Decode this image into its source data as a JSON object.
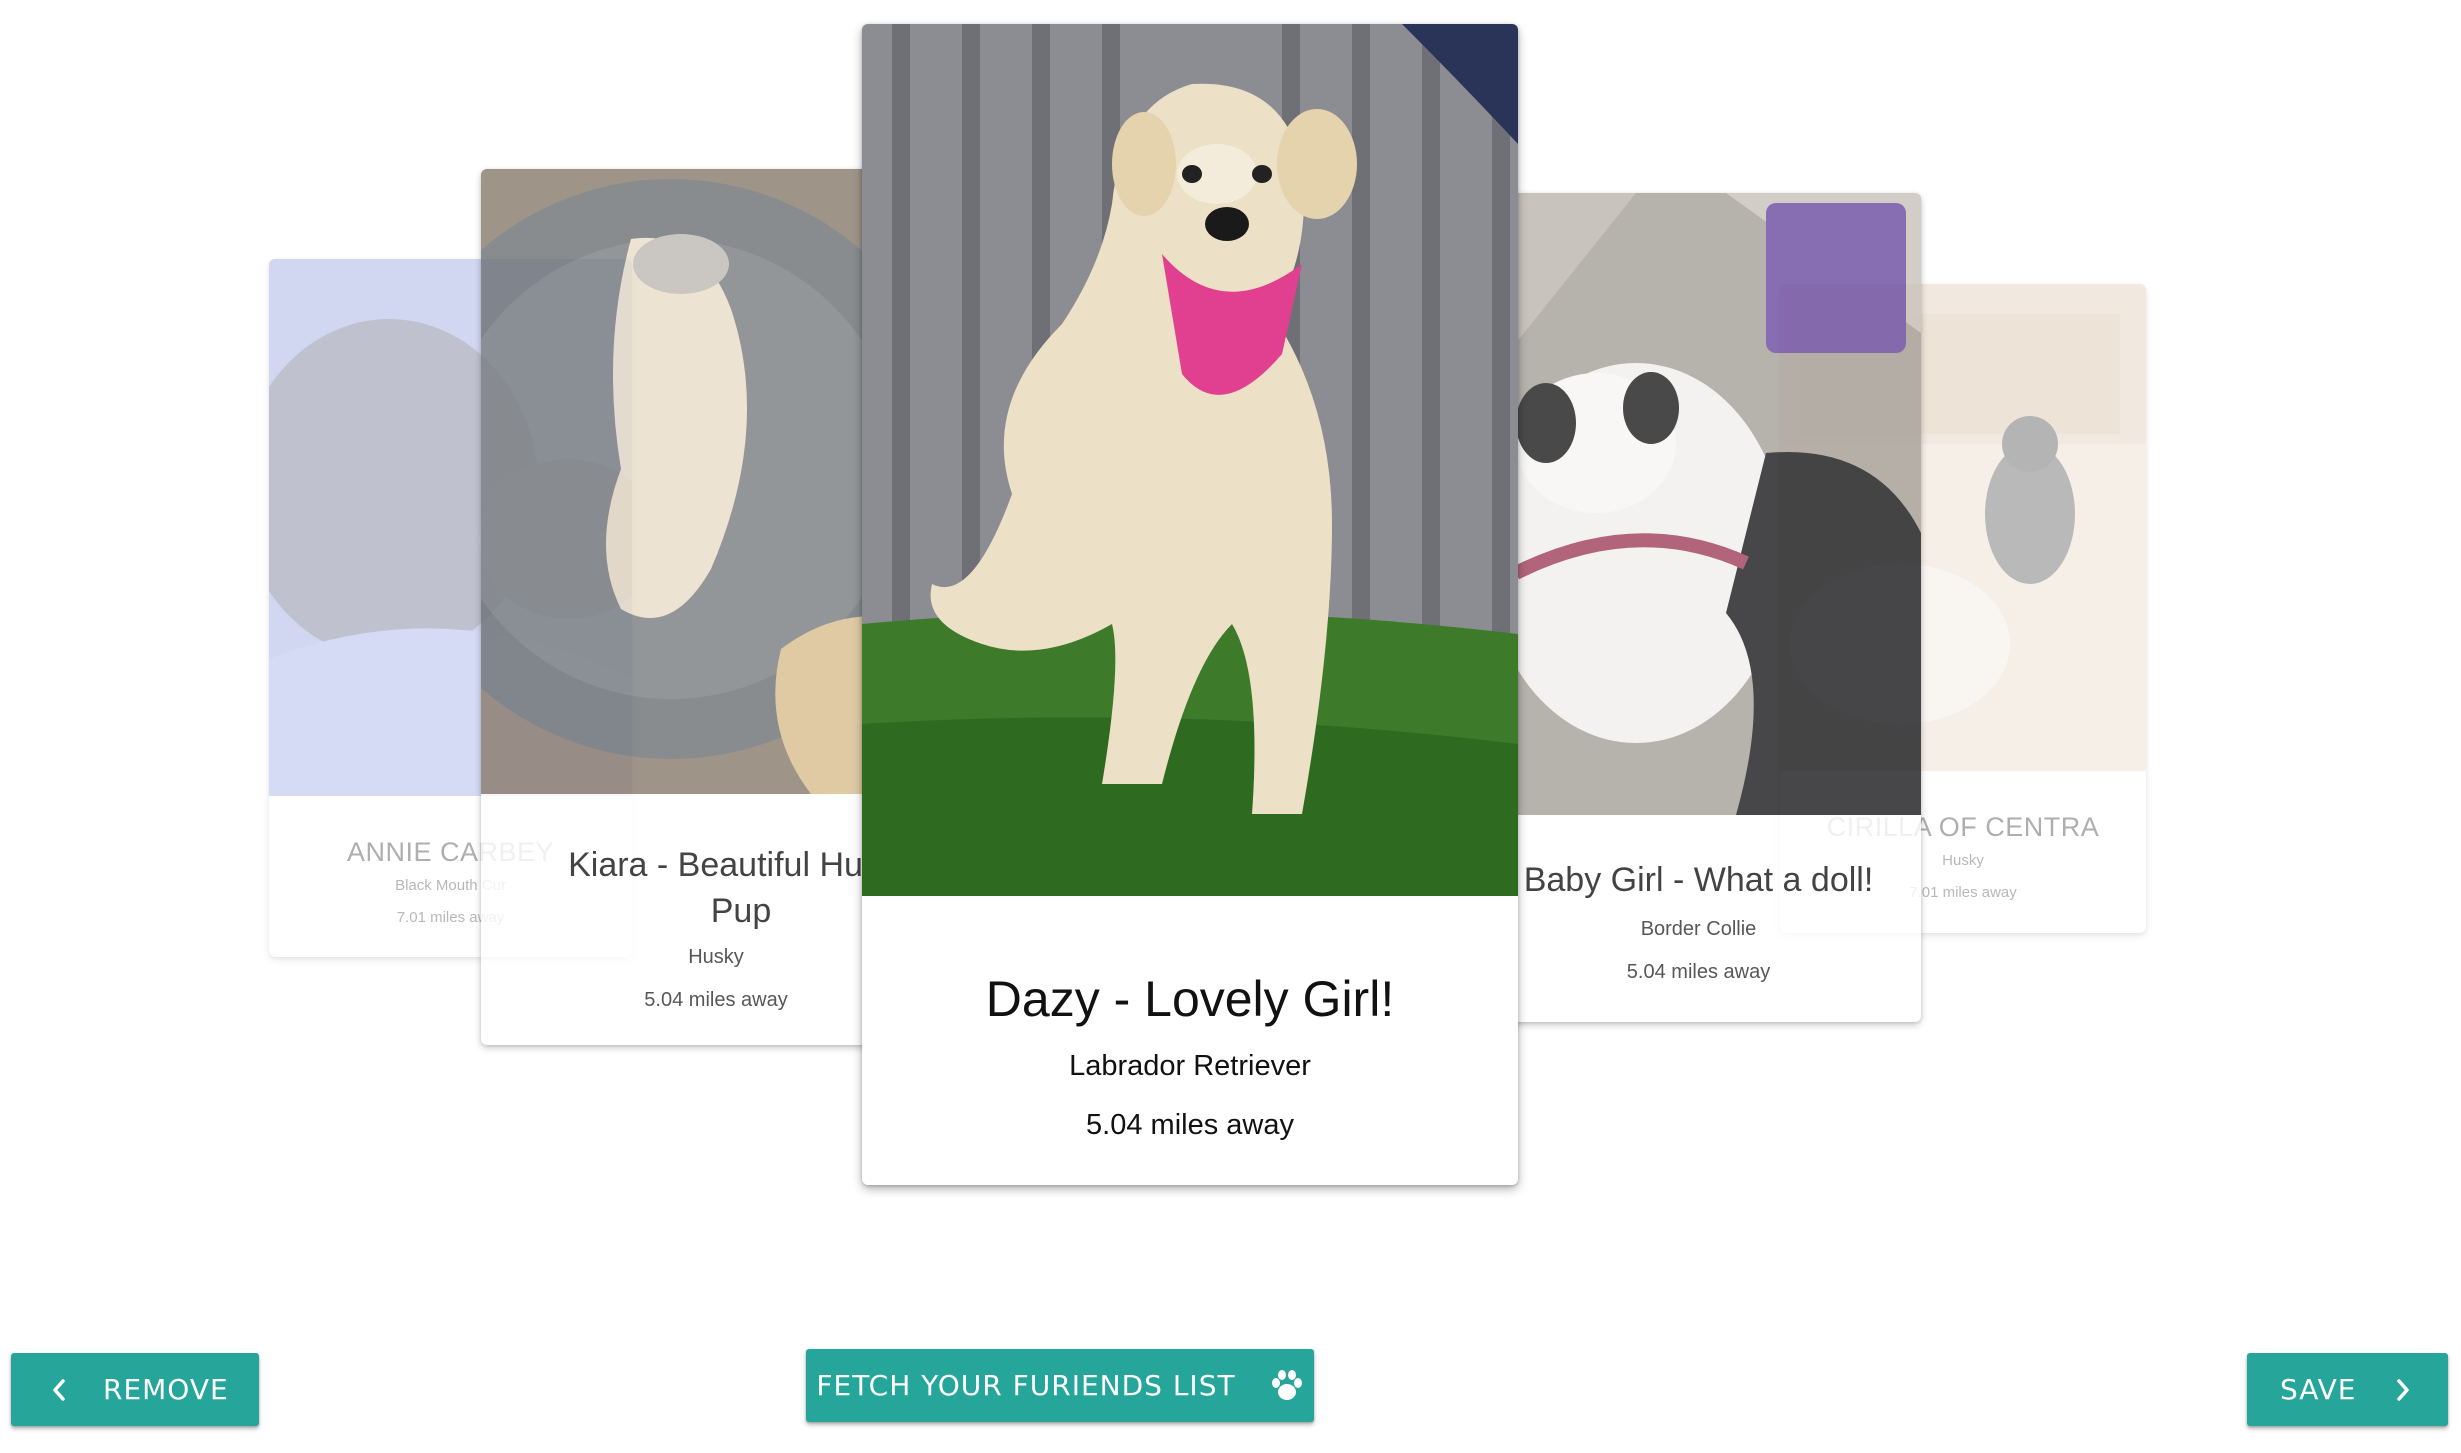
{
  "cards": {
    "annie": {
      "name": "ANNIE CARBEY",
      "breed": "Black Mouth Cur",
      "distance": "7.01 miles away"
    },
    "kiara": {
      "name": "Kiara - Beautiful Husky Pup",
      "breed": "Husky",
      "distance": "5.04 miles away"
    },
    "dazy": {
      "name": "Dazy - Lovely Girl!",
      "breed": "Labrador Retriever",
      "distance": "5.04 miles away"
    },
    "baby_girl": {
      "name": "Baby Girl - What a doll!",
      "breed": "Border Collie",
      "distance": "5.04 miles away"
    },
    "cirilla": {
      "name": "CIRILLA OF CENTRA",
      "breed": "Husky",
      "distance": "7.01 miles away"
    }
  },
  "actions": {
    "remove_label": "REMOVE",
    "fetch_label": "FETCH YOUR FURIENDS LIST",
    "save_label": "SAVE"
  },
  "colors": {
    "accent": "#26a69a",
    "button_text": "#ffffff"
  },
  "icons": {
    "remove": "chevron-left-icon",
    "fetch": "paw-icon",
    "save": "chevron-right-icon"
  }
}
